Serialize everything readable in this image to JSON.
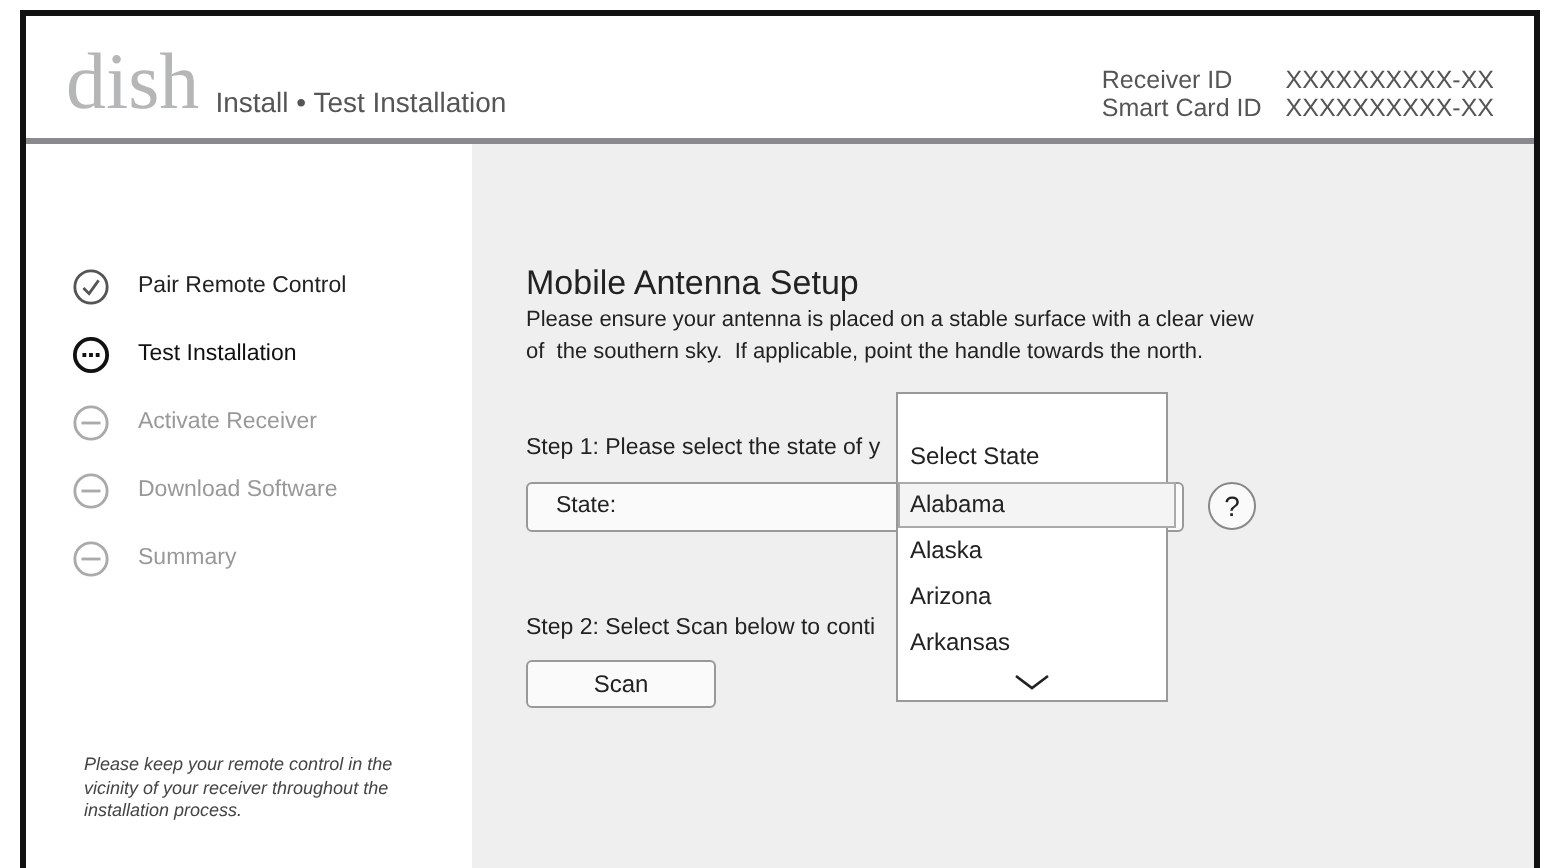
{
  "header": {
    "logo": "dish",
    "breadcrumb": "Install • Test Installation",
    "ids": [
      {
        "label": "Receiver ID",
        "value": "XXXXXXXXXX-XX"
      },
      {
        "label": "Smart Card ID",
        "value": "XXXXXXXXXX-XX"
      }
    ]
  },
  "steps": [
    {
      "label": "Pair Remote Control",
      "kind": "done"
    },
    {
      "label": "Test Installation",
      "kind": "current"
    },
    {
      "label": "Activate Receiver",
      "kind": "pending"
    },
    {
      "label": "Download Software",
      "kind": "pending"
    },
    {
      "label": "Summary",
      "kind": "pending"
    }
  ],
  "sidebar_note": "Please keep your remote control in the vicinity of your receiver throughout the installation process.",
  "main": {
    "title": "Mobile Antenna Setup",
    "intro": [
      "Please ensure your antenna is placed on a stable surface with a clear view",
      "of  the southern sky.  If applicable, point the handle towards the north."
    ],
    "step1": "Step 1: Please select the state of y",
    "state_field": {
      "label": "State:"
    },
    "help": "?",
    "step2": "Step 2: Select Scan below to conti",
    "scan_button": "Scan"
  },
  "dropdown": {
    "heading": "Select State",
    "options": [
      {
        "label": "Alabama",
        "selected": true
      },
      {
        "label": "Alaska",
        "selected": false
      },
      {
        "label": "Arizona",
        "selected": false
      },
      {
        "label": "Arkansas",
        "selected": false
      }
    ]
  }
}
